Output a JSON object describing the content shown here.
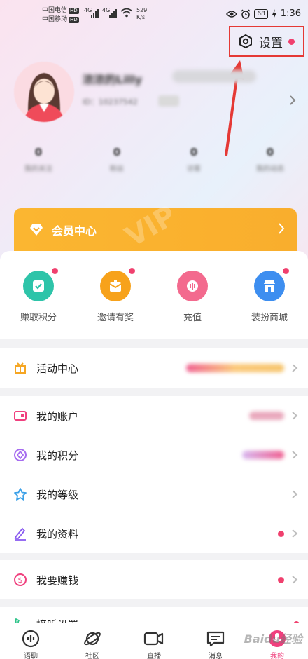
{
  "status_bar": {
    "carrier1": "中国电信",
    "carrier2": "中国移动",
    "hd": "HD",
    "net1": "4G",
    "net2": "4G",
    "speed_value": "529",
    "speed_unit": "K/s",
    "battery": "68",
    "time": "1:36"
  },
  "header": {
    "settings_label": "设置"
  },
  "profile": {
    "username": "浓浓的Lilly",
    "uid": "ID：10237542"
  },
  "stats": [
    {
      "value": "0",
      "label": "我的关注"
    },
    {
      "value": "0",
      "label": "粉丝"
    },
    {
      "value": "0",
      "label": "访客"
    },
    {
      "value": "0",
      "label": "我的动态"
    }
  ],
  "member": {
    "label": "会员中心",
    "watermark": "VIP"
  },
  "quick_actions": [
    {
      "label": "赚取积分",
      "color": "#2ec4a9",
      "icon": "check-icon"
    },
    {
      "label": "邀请有奖",
      "color": "#f7a21b",
      "icon": "gift-envelope-icon"
    },
    {
      "label": "充值",
      "color": "#f36a8e",
      "icon": "recharge-icon"
    },
    {
      "label": "装扮商城",
      "color": "#3d8ef0",
      "icon": "shop-icon"
    }
  ],
  "menu": {
    "activity": "活动中心",
    "account": "我的账户",
    "points": "我的积分",
    "level": "我的等级",
    "profile": "我的资料",
    "earn": "我要赚钱",
    "listen_settings": "接听设置"
  },
  "tabs": [
    {
      "label": "语聊"
    },
    {
      "label": "社区"
    },
    {
      "label": "直播"
    },
    {
      "label": "消息"
    },
    {
      "label": "我的"
    }
  ],
  "watermark": "Baidu经验",
  "colors": {
    "accent": "#f0407e",
    "member_gold": "#fbb631",
    "highlight_red": "#e53935"
  }
}
